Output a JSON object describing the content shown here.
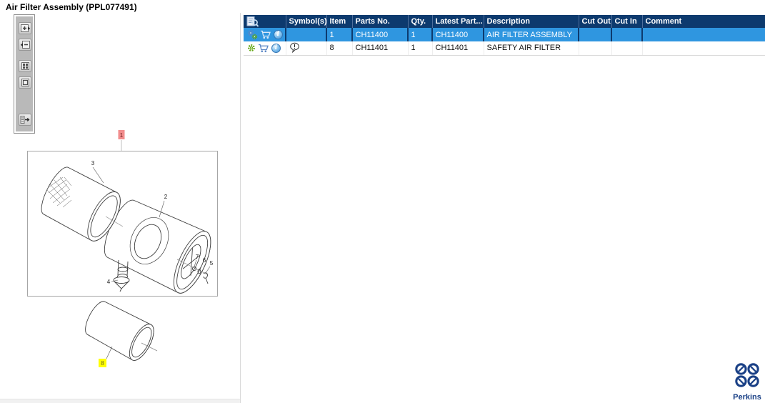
{
  "window": {
    "title": "Air Filter Assembly (PPL077491)"
  },
  "viewer_toolbar": {
    "buttons": [
      {
        "icon": "zoom-in-icon"
      },
      {
        "icon": "zoom-out-icon"
      },
      {
        "icon": "tile-view-icon"
      },
      {
        "icon": "fit-page-icon"
      },
      {
        "icon": "toggle-panel-icon"
      }
    ]
  },
  "diagram": {
    "callouts": {
      "c1": "1",
      "c2": "2",
      "c3": "3",
      "c4": "4",
      "c5": "5",
      "c6": "6",
      "c7": "7",
      "c8": "8"
    },
    "red_highlighted_callout": "1",
    "yellow_highlighted_callout": "8"
  },
  "table": {
    "columns": [
      {
        "key": "actions",
        "label": "",
        "icon": "parts-list-preview-icon"
      },
      {
        "key": "symbols",
        "label": "Symbol(s)"
      },
      {
        "key": "item",
        "label": "Item"
      },
      {
        "key": "parts_no",
        "label": "Parts No."
      },
      {
        "key": "qty",
        "label": "Qty."
      },
      {
        "key": "latest",
        "label": "Latest Part..."
      },
      {
        "key": "description",
        "label": "Description"
      },
      {
        "key": "cut_out",
        "label": "Cut Out"
      },
      {
        "key": "cut_in",
        "label": "Cut In"
      },
      {
        "key": "comment",
        "label": "Comment"
      }
    ],
    "rows": [
      {
        "selected": true,
        "icons": [
          "gears-icon",
          "cart-icon",
          "info-icon"
        ],
        "symbol": "",
        "item": "1",
        "parts_no": "CH11400",
        "qty": "1",
        "latest": "CH11400",
        "description": "AIR FILTER ASSEMBLY",
        "cut_out": "",
        "cut_in": "",
        "comment": ""
      },
      {
        "selected": false,
        "icons": [
          "gear-icon",
          "cart-icon",
          "info-icon"
        ],
        "symbol": "note-balloon-icon",
        "item": "8",
        "parts_no": "CH11401",
        "qty": "1",
        "latest": "CH11401",
        "description": "SAFETY AIR FILTER",
        "cut_out": "",
        "cut_in": "",
        "comment": ""
      }
    ]
  },
  "logo": {
    "text": "Perkins"
  },
  "colors": {
    "header_bg": "#0d3a6e",
    "selected_row_bg": "#2f96e0",
    "accent_green": "#63a712",
    "accent_blue": "#5b87c5",
    "red_label_bg": "#f28d8d",
    "yellow_label_bg": "#ffff00",
    "logo_navy": "#1a4086"
  }
}
